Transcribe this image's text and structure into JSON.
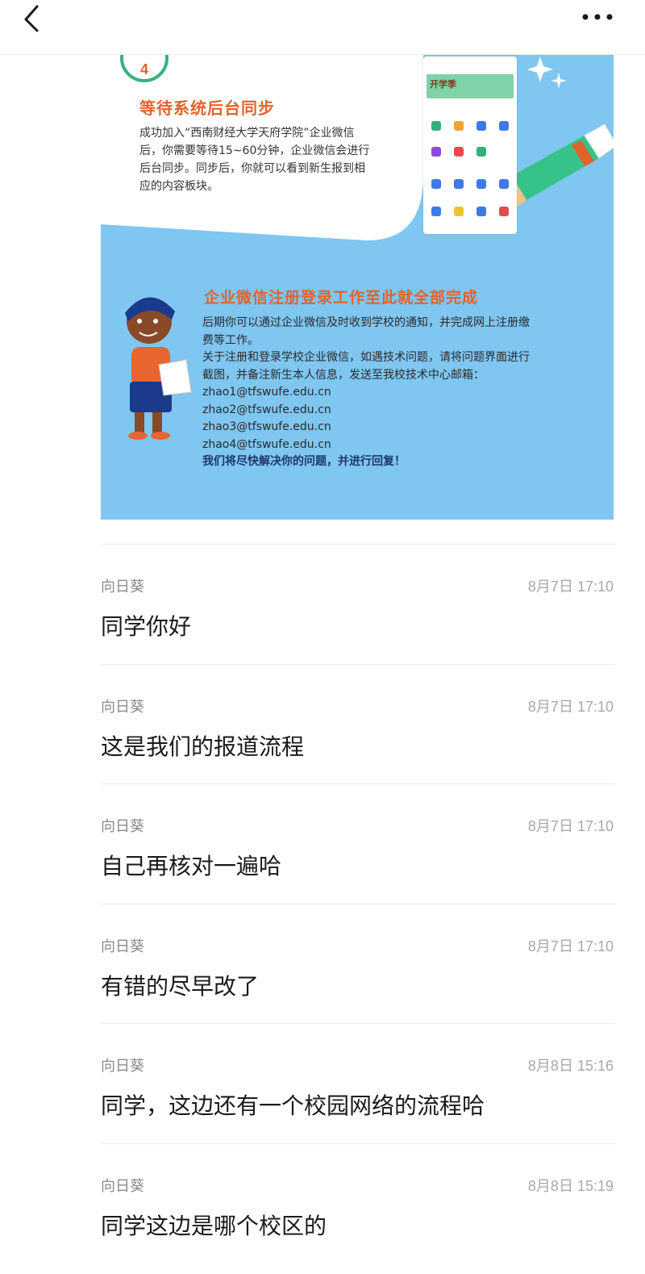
{
  "header": {
    "back_icon": "chevron-left-icon",
    "more_icon": "more-dots-icon"
  },
  "card": {
    "step_number": "4",
    "step_title": "等待系统后台同步",
    "step_desc_lines": [
      "成功加入“西南财经大学天府学院”企业微信",
      "后，你需要等待15~60分钟，企业微信会进行",
      "后台同步。同步后，你就可以看到新生报到相",
      "应的内容板块。"
    ],
    "phone_banner_text": "开学季",
    "done_title": "企业微信注册登录工作至此就全部完成",
    "done_lines": [
      "后期你可以通过企业微信及时收到学校的通知，并完成网上注册缴",
      "费等工作。",
      "关于注册和登录学校企业微信，如遇技术问题，请将问题界面进行",
      "截图，并备注新生本人信息，发送至我校技术中心邮箱：",
      "zhao1@tfswufe.edu.cn",
      "zhao2@tfswufe.edu.cn",
      "zhao3@tfswufe.edu.cn",
      "zhao4@tfswufe.edu.cn"
    ],
    "done_bold": "我们将尽快解决你的问题，并进行回复！",
    "colors": {
      "card_bg": "#7fc6f1",
      "accent_orange": "#e3622a",
      "badge_green": "#37b27a"
    }
  },
  "messages": [
    {
      "sender": "向日葵",
      "time": "8月7日 17:10",
      "text": "同学你好"
    },
    {
      "sender": "向日葵",
      "time": "8月7日 17:10",
      "text": "这是我们的报道流程"
    },
    {
      "sender": "向日葵",
      "time": "8月7日 17:10",
      "text": "自己再核对一遍哈"
    },
    {
      "sender": "向日葵",
      "time": "8月7日 17:10",
      "text": "有错的尽早改了"
    },
    {
      "sender": "向日葵",
      "time": "8月8日 15:16",
      "text": "同学，这边还有一个校园网络的流程哈"
    },
    {
      "sender": "向日葵",
      "time": "8月8日 15:19",
      "text": "同学这边是哪个校区的"
    }
  ]
}
